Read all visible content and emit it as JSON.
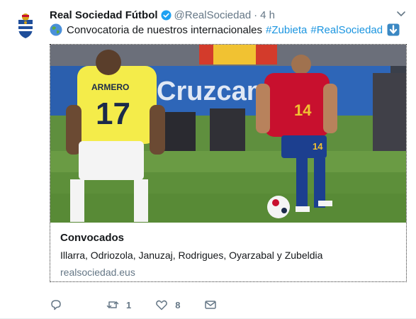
{
  "tweet": {
    "author_name": "Real Sociedad Fútbol",
    "handle": "@RealSociedad",
    "separator": "·",
    "time": "4 h",
    "text_main": "Convocatoria de nuestros internacionales",
    "hashtags": [
      "#Zubieta",
      "#RealSociedad"
    ]
  },
  "card": {
    "title": "Convocados",
    "description": "Illarra, Odriozola, Januzaj, Rodrigues, Oyarzabal y Zubeldia",
    "domain": "realsociedad.eus",
    "image_text": {
      "left_player_name": "ARMERO",
      "left_player_number": "17",
      "right_player_number": "14",
      "shorts_number": "14",
      "board_text": "Cruzcam"
    }
  },
  "actions": {
    "reply_count": "",
    "retweet_count": "1",
    "like_count": "8"
  },
  "colors": {
    "verified": "#1da1f2",
    "hashtag": "#1b95e0",
    "muted": "#657786",
    "spain_red": "#c8102e",
    "colombia_yellow": "#f4ec4a"
  }
}
